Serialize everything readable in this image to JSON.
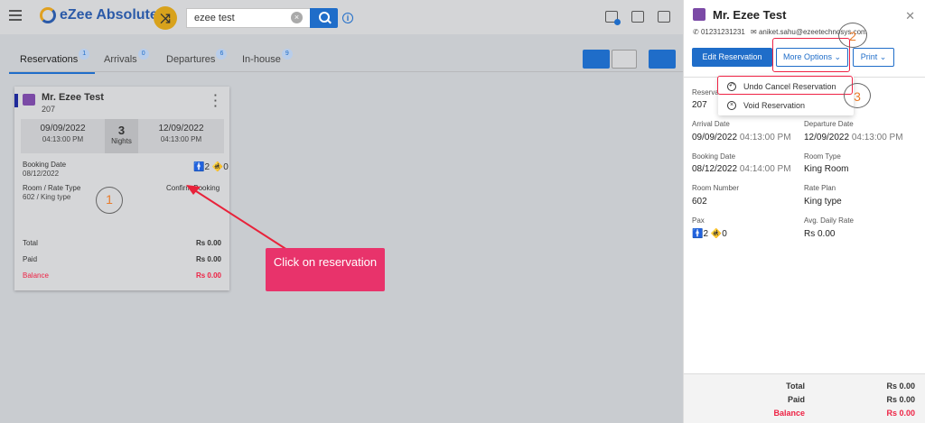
{
  "app": {
    "name": "eZee Absolute"
  },
  "search": {
    "value": "ezee test",
    "clear": "×"
  },
  "info_icon": "i",
  "tabs": [
    {
      "label": "Reservations",
      "count": "1"
    },
    {
      "label": "Arrivals",
      "count": "0"
    },
    {
      "label": "Departures",
      "count": "6"
    },
    {
      "label": "In-house",
      "count": "9"
    }
  ],
  "card": {
    "guest_name": "Mr. Ezee Test",
    "room_no": "207",
    "arrival_date": "09/09/2022",
    "arrival_time": "04:13:00 PM",
    "nights": "3",
    "nights_label": "Nights",
    "departure_date": "12/09/2022",
    "departure_time": "04:13:00 PM",
    "booking_date_label": "Booking Date",
    "booking_date": "08/12/2022",
    "adults": "2",
    "children": "0",
    "room_rate_label": "Room / Rate Type",
    "room_rate": "602 / King type",
    "status": "Confirm Booking",
    "total_label": "Total",
    "total": "Rs 0.00",
    "paid_label": "Paid",
    "paid": "Rs 0.00",
    "balance_label": "Balance",
    "balance": "Rs 0.00"
  },
  "annotations": {
    "callout": "Click on reservation",
    "step1": "1",
    "step2": "2",
    "step3": "3"
  },
  "panel": {
    "guest_name": "Mr. Ezee Test",
    "phone": "01231231231",
    "email": "aniket.sahu@ezeetechnosys.com",
    "edit_button": "Edit Reservation",
    "more_options": "More Options",
    "print": "Print",
    "menu": [
      {
        "label": "Undo Cancel Reservation",
        "icon": "undo-icon"
      },
      {
        "label": "Void Reservation",
        "icon": "void-icon"
      }
    ],
    "reservation_label": "Reservation",
    "reservation_value": "207",
    "arrival_label": "Arrival Date",
    "arrival_date": "09/09/2022",
    "arrival_time": "04:13:00 PM",
    "departure_label": "Departure Date",
    "departure_date": "12/09/2022",
    "departure_time": "04:13:00 PM",
    "booking_label": "Booking Date",
    "booking_date": "08/12/2022",
    "booking_time": "04:14:00 PM",
    "room_type_label": "Room Type",
    "room_type": "King Room",
    "room_number_label": "Room Number",
    "room_number": "602",
    "rate_plan_label": "Rate Plan",
    "rate_plan": "King type",
    "pax_label": "Pax",
    "pax_adults": "2",
    "pax_children": "0",
    "adr_label": "Avg. Daily Rate",
    "adr": "Rs 0.00",
    "total_label": "Total",
    "total": "Rs 0.00",
    "paid_label": "Paid",
    "paid": "Rs 0.00",
    "balance_label": "Balance",
    "balance": "Rs 0.00"
  },
  "colors": {
    "primary": "#1f6dc9",
    "danger": "#e24444",
    "callout": "#e8336b",
    "annotation": "#e87a2a"
  }
}
